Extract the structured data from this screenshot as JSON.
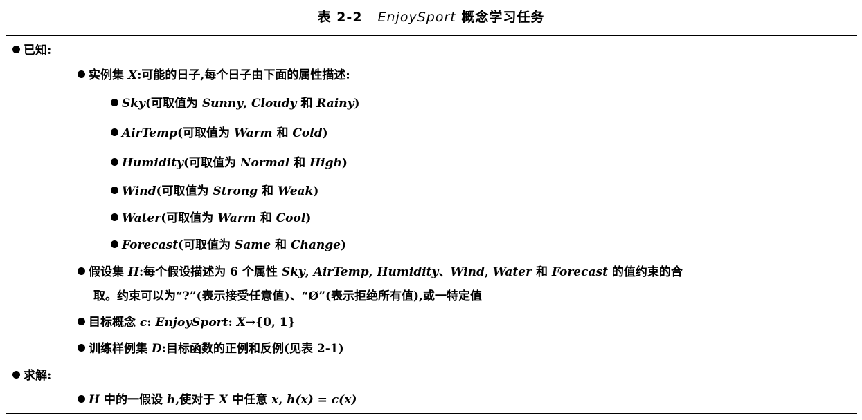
{
  "title": {
    "number": "表 2-2",
    "name": "EnjoySport",
    "rest": "概念学习任务"
  },
  "given": {
    "label": "已知:"
  },
  "instances": {
    "prefix": "实例集 ",
    "var": "X",
    "text": ":可能的日子,每个日子由下面的属性描述:"
  },
  "attributes": [
    {
      "name": "Sky",
      "pre": "(可取值为 ",
      "v1": "Sunny",
      "sep1": ", ",
      "v2": "Cloudy",
      "sep2": " 和 ",
      "v3": "Rainy",
      "post": ")"
    },
    {
      "name": "AirTemp",
      "pre": "(可取值为 ",
      "v1": "Warm",
      "sep1": " 和 ",
      "v2": "Cold",
      "post": ")"
    },
    {
      "name": "Humidity",
      "pre": "(可取值为 ",
      "v1": "Normal",
      "sep1": " 和 ",
      "v2": "High",
      "post": ")"
    },
    {
      "name": "Wind",
      "pre": "(可取值为 ",
      "v1": "Strong",
      "sep1": " 和 ",
      "v2": "Weak",
      "post": ")"
    },
    {
      "name": "Water",
      "pre": "(可取值为 ",
      "v1": "Warm",
      "sep1": " 和 ",
      "v2": "Cool",
      "post": ")"
    },
    {
      "name": "Forecast",
      "pre": "(可取值为 ",
      "v1": "Same",
      "sep1": " 和 ",
      "v2": "Change",
      "post": ")"
    }
  ],
  "hypotheses": {
    "prefix": "假设集 ",
    "var": "H",
    "text1": ":每个假设描述为 6 个属性 ",
    "a1": "Sky",
    "c1": ", ",
    "a2": "AirTemp",
    "c2": ", ",
    "a3": "Humidity",
    "c3": "、",
    "a4": "Wind",
    "c4": ", ",
    "a5": "Water",
    "c5": " 和 ",
    "a6": "Forecast",
    "text2": " 的值约束的合",
    "line2": "取。约束可以为“?”(表示接受任意值)、“Ø”(表示拒绝所有值),或一特定值"
  },
  "target": {
    "prefix": "目标概念 ",
    "var": "c",
    "sep": ": ",
    "name": "EnjoySport",
    "sep2": ": ",
    "map": "X",
    "arrow": "→{0, 1}"
  },
  "training": {
    "prefix": "训练样例集 ",
    "var": "D",
    "text": ":目标函数的正例和反例(见表 2-1)"
  },
  "solve": {
    "label": "求解:"
  },
  "goal": {
    "var": "H",
    "text1": " 中的一假设 ",
    "h": "h",
    "text2": ",使对于 ",
    "x1": "X",
    "text3": " 中任意 ",
    "x2": "x",
    "text4": ", ",
    "formula": "h(x) = c(x)"
  }
}
